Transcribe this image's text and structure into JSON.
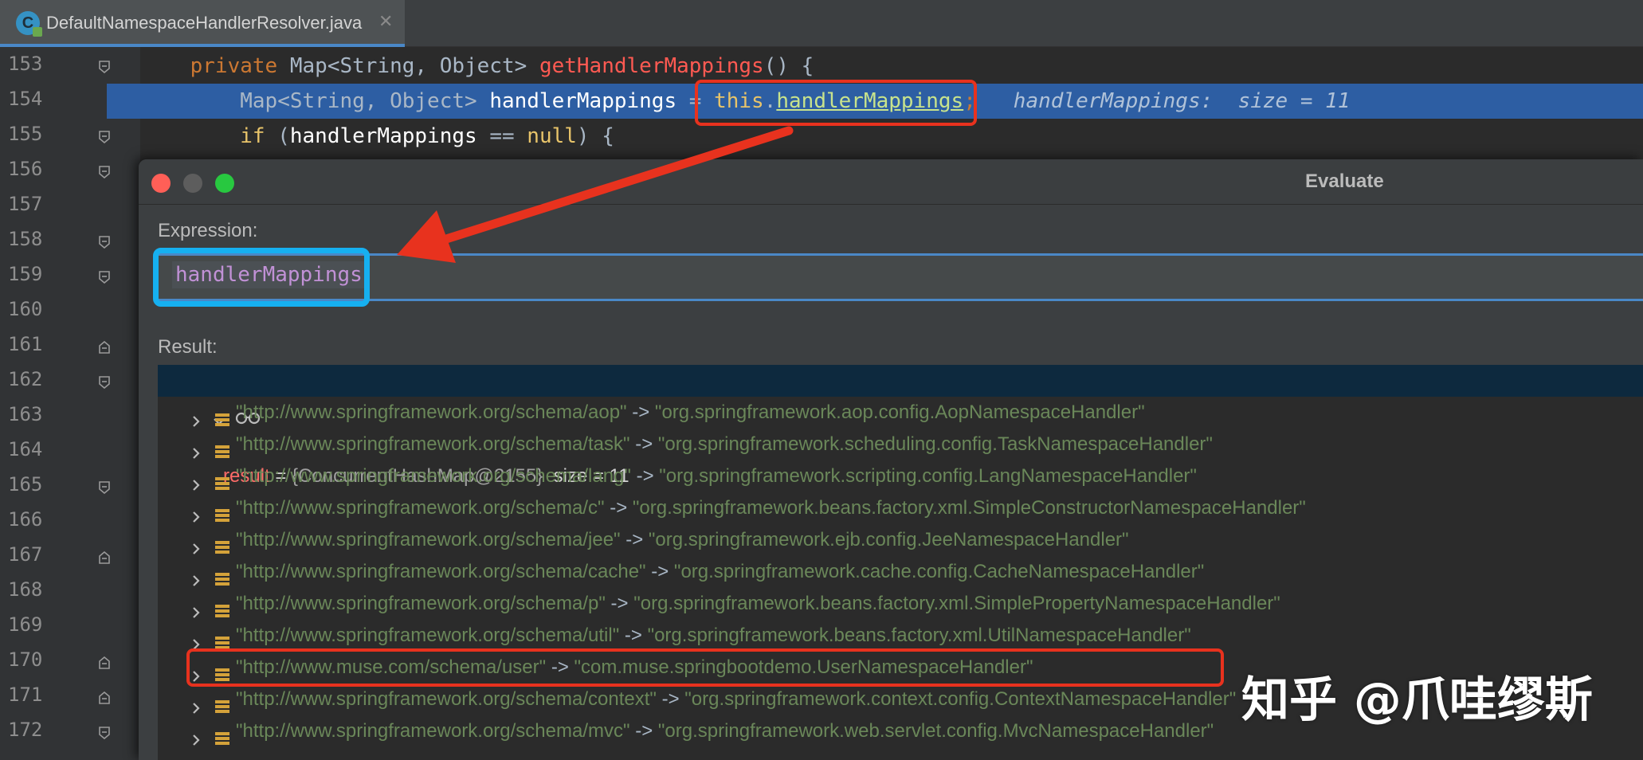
{
  "tab": {
    "icon_letter": "C",
    "filename": "DefaultNamespaceHandlerResolver.java",
    "close": "✕"
  },
  "gutter": {
    "line_numbers": [
      "153",
      "154",
      "155",
      "156",
      "157",
      "158",
      "159",
      "160",
      "161",
      "162",
      "163",
      "164",
      "165",
      "166",
      "167",
      "168",
      "169",
      "170",
      "171",
      "172"
    ]
  },
  "code": {
    "line153": {
      "indent": "    ",
      "kw": "private",
      "type": " Map<String, Object> ",
      "fn": "getHandlerMappings",
      "rest": "() {"
    },
    "line154": {
      "indent": "        ",
      "type": "Map<String, Object> ",
      "var": "handlerMappings",
      "eq": " = ",
      "this": "this",
      "dot": ".",
      "field": "handlerMappings",
      "semi": ";",
      "inline_value": "   handlerMappings:  size = 11"
    },
    "line155": {
      "indent": "        ",
      "kw": "if",
      "open": " (",
      "var": "handlerMappings",
      "op": " == ",
      "null": "null",
      "close": ") {"
    }
  },
  "dialog": {
    "title": "Evaluate",
    "expression_label": "Expression:",
    "expression_value": "handlerMappings",
    "result_label": "Result:",
    "result": {
      "name": "result",
      "eq": " = ",
      "type": "{ConcurrentHashMap@2155}",
      "size": "  size = 11"
    },
    "entries": [
      {
        "key": "\"http://www.springframework.org/schema/aop\"",
        "value": "\"org.springframework.aop.config.AopNamespaceHandler\""
      },
      {
        "key": "\"http://www.springframework.org/schema/task\"",
        "value": "\"org.springframework.scheduling.config.TaskNamespaceHandler\""
      },
      {
        "key": "\"http://www.springframework.org/schema/lang\"",
        "value": "\"org.springframework.scripting.config.LangNamespaceHandler\""
      },
      {
        "key": "\"http://www.springframework.org/schema/c\"",
        "value": "\"org.springframework.beans.factory.xml.SimpleConstructorNamespaceHandler\""
      },
      {
        "key": "\"http://www.springframework.org/schema/jee\"",
        "value": "\"org.springframework.ejb.config.JeeNamespaceHandler\""
      },
      {
        "key": "\"http://www.springframework.org/schema/cache\"",
        "value": "\"org.springframework.cache.config.CacheNamespaceHandler\""
      },
      {
        "key": "\"http://www.springframework.org/schema/p\"",
        "value": "\"org.springframework.beans.factory.xml.SimplePropertyNamespaceHandler\""
      },
      {
        "key": "\"http://www.springframework.org/schema/util\"",
        "value": "\"org.springframework.beans.factory.xml.UtilNamespaceHandler\""
      },
      {
        "key": "\"http://www.muse.com/schema/user\"",
        "value": "\"com.muse.springbootdemo.UserNamespaceHandler\""
      },
      {
        "key": "\"http://www.springframework.org/schema/context\"",
        "value": "\"org.springframework.context.config.ContextNamespaceHandler\""
      },
      {
        "key": "\"http://www.springframework.org/schema/mvc\"",
        "value": "\"org.springframework.web.servlet.config.MvcNamespaceHandler\""
      }
    ],
    "arrow": " -> "
  },
  "watermark": "知乎 @爪哇缪斯",
  "colors": {
    "annotation_red": "#e8321e",
    "annotation_blue": "#16b0f0",
    "highlight_line": "#2d5ea3"
  },
  "icons": {
    "tab": "java-class-icon",
    "fold": "fold-marker-icon",
    "watch": "watch-glasses-icon",
    "entry": "map-entry-icon",
    "expand": "chevron-right-icon",
    "collapse": "chevron-down-icon"
  }
}
